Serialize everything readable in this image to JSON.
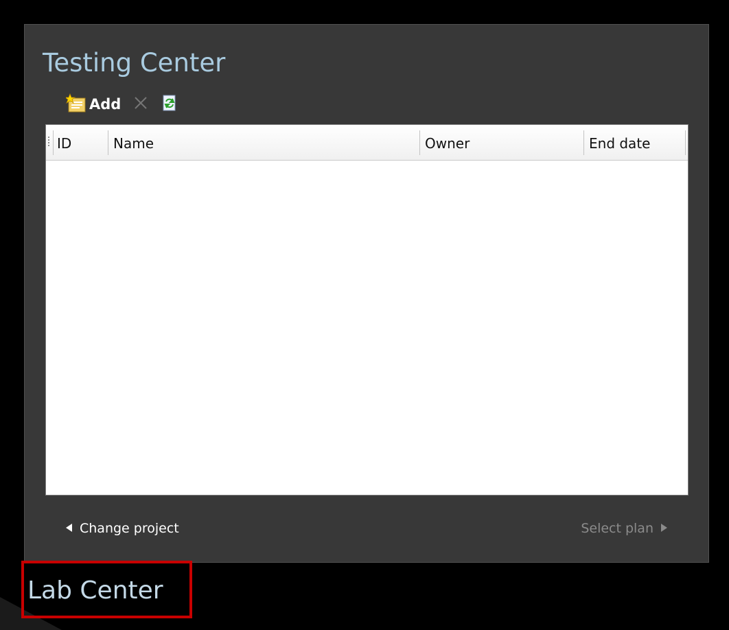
{
  "testing_center": {
    "title": "Testing Center",
    "toolbar": {
      "add_label": "Add",
      "add_icon": "new-item-icon",
      "delete_icon": "close-icon",
      "refresh_icon": "refresh-icon"
    },
    "table": {
      "columns": [
        "ID",
        "Name",
        "Owner",
        "End date"
      ],
      "rows": []
    },
    "navigation": {
      "back_label": "Change project",
      "next_label": "Select plan"
    }
  },
  "lab_center": {
    "label": "Lab Center",
    "highlight_color": "#c80000"
  }
}
